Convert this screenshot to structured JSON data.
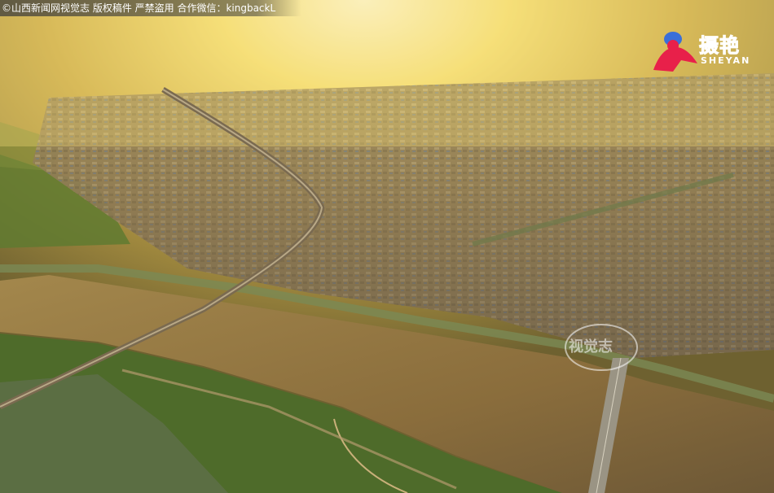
{
  "overlay": {
    "copyright_text": "©山西新闻网视觉志  版权稿件  严禁盗用  合作微信：kingbackL"
  },
  "logo": {
    "cn_text": "摄艳",
    "en_text": "SHEYAN",
    "brand_color": "#e8204a"
  },
  "watermark": {
    "text": "视觉志"
  },
  "colors": {
    "sky_glow": "#fff6b0",
    "haze": "#e9c95a",
    "city": "#8a7a55",
    "river": "#8f7240",
    "grass": "#4e6b2a"
  }
}
